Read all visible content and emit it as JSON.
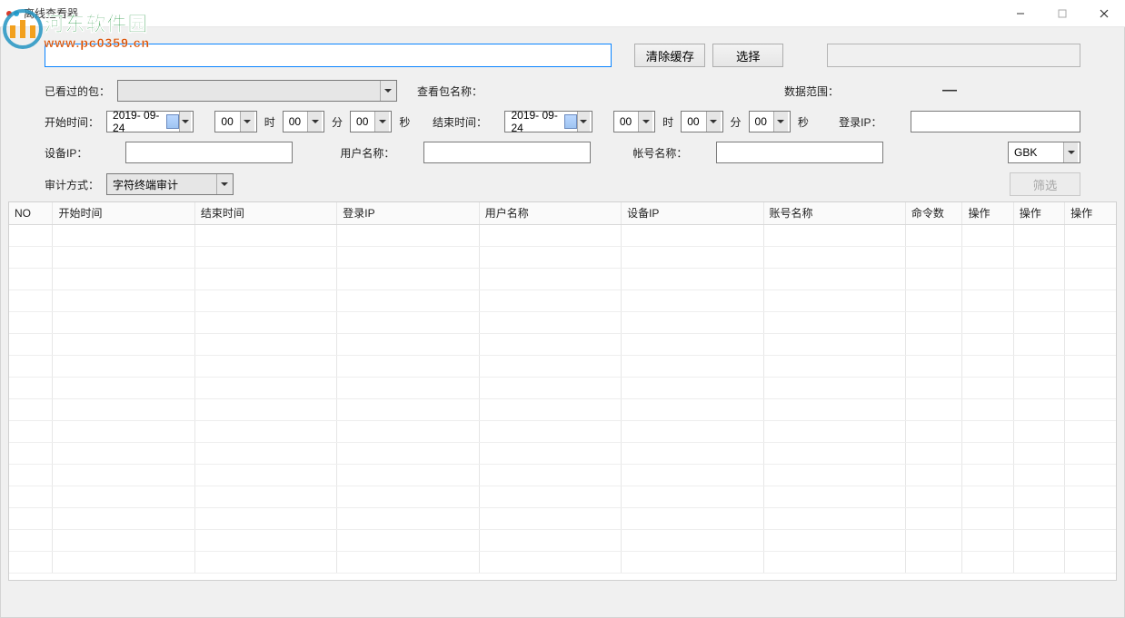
{
  "window": {
    "title": "离线查看器"
  },
  "watermark": {
    "cn": "河东软件园",
    "url": "www.pc0359.cn"
  },
  "toolbar": {
    "path_value": "",
    "clear_cache": "清除缓存",
    "select": "选择"
  },
  "row_viewed": {
    "viewed_label": "已看过的包：",
    "viewed_value": "",
    "pkg_name_label": "查看包名称：",
    "pkg_name_value": "",
    "range_label": "数据范围：",
    "range_value": "—"
  },
  "row_time": {
    "start_label": "开始时间：",
    "start_date": "2019- 09- 24",
    "start_h": "00",
    "unit_h": "时",
    "start_m": "00",
    "unit_m": "分",
    "start_s": "00",
    "unit_s": "秒",
    "end_label": "结束时间：",
    "end_date": "2019- 09- 24",
    "end_h": "00",
    "end_m": "00",
    "end_s": "00",
    "login_ip_label": "登录IP：",
    "login_ip_value": ""
  },
  "row_dev": {
    "device_ip_label": "设备IP：",
    "device_ip_value": "",
    "user_label": "用户名称：",
    "user_value": "",
    "account_label": "帐号名称：",
    "account_value": "",
    "encoding_value": "GBK"
  },
  "row_audit": {
    "audit_label": "审计方式：",
    "audit_value": "字符终端审计",
    "filter_btn": "筛选"
  },
  "grid": {
    "cols": {
      "no": "NO",
      "start": "开始时间",
      "end": "结束时间",
      "login_ip": "登录IP",
      "user": "用户名称",
      "device_ip": "设备IP",
      "account": "账号名称",
      "cmd": "命令数",
      "op1": "操作",
      "op2": "操作",
      "op3": "操作"
    },
    "rows": []
  }
}
